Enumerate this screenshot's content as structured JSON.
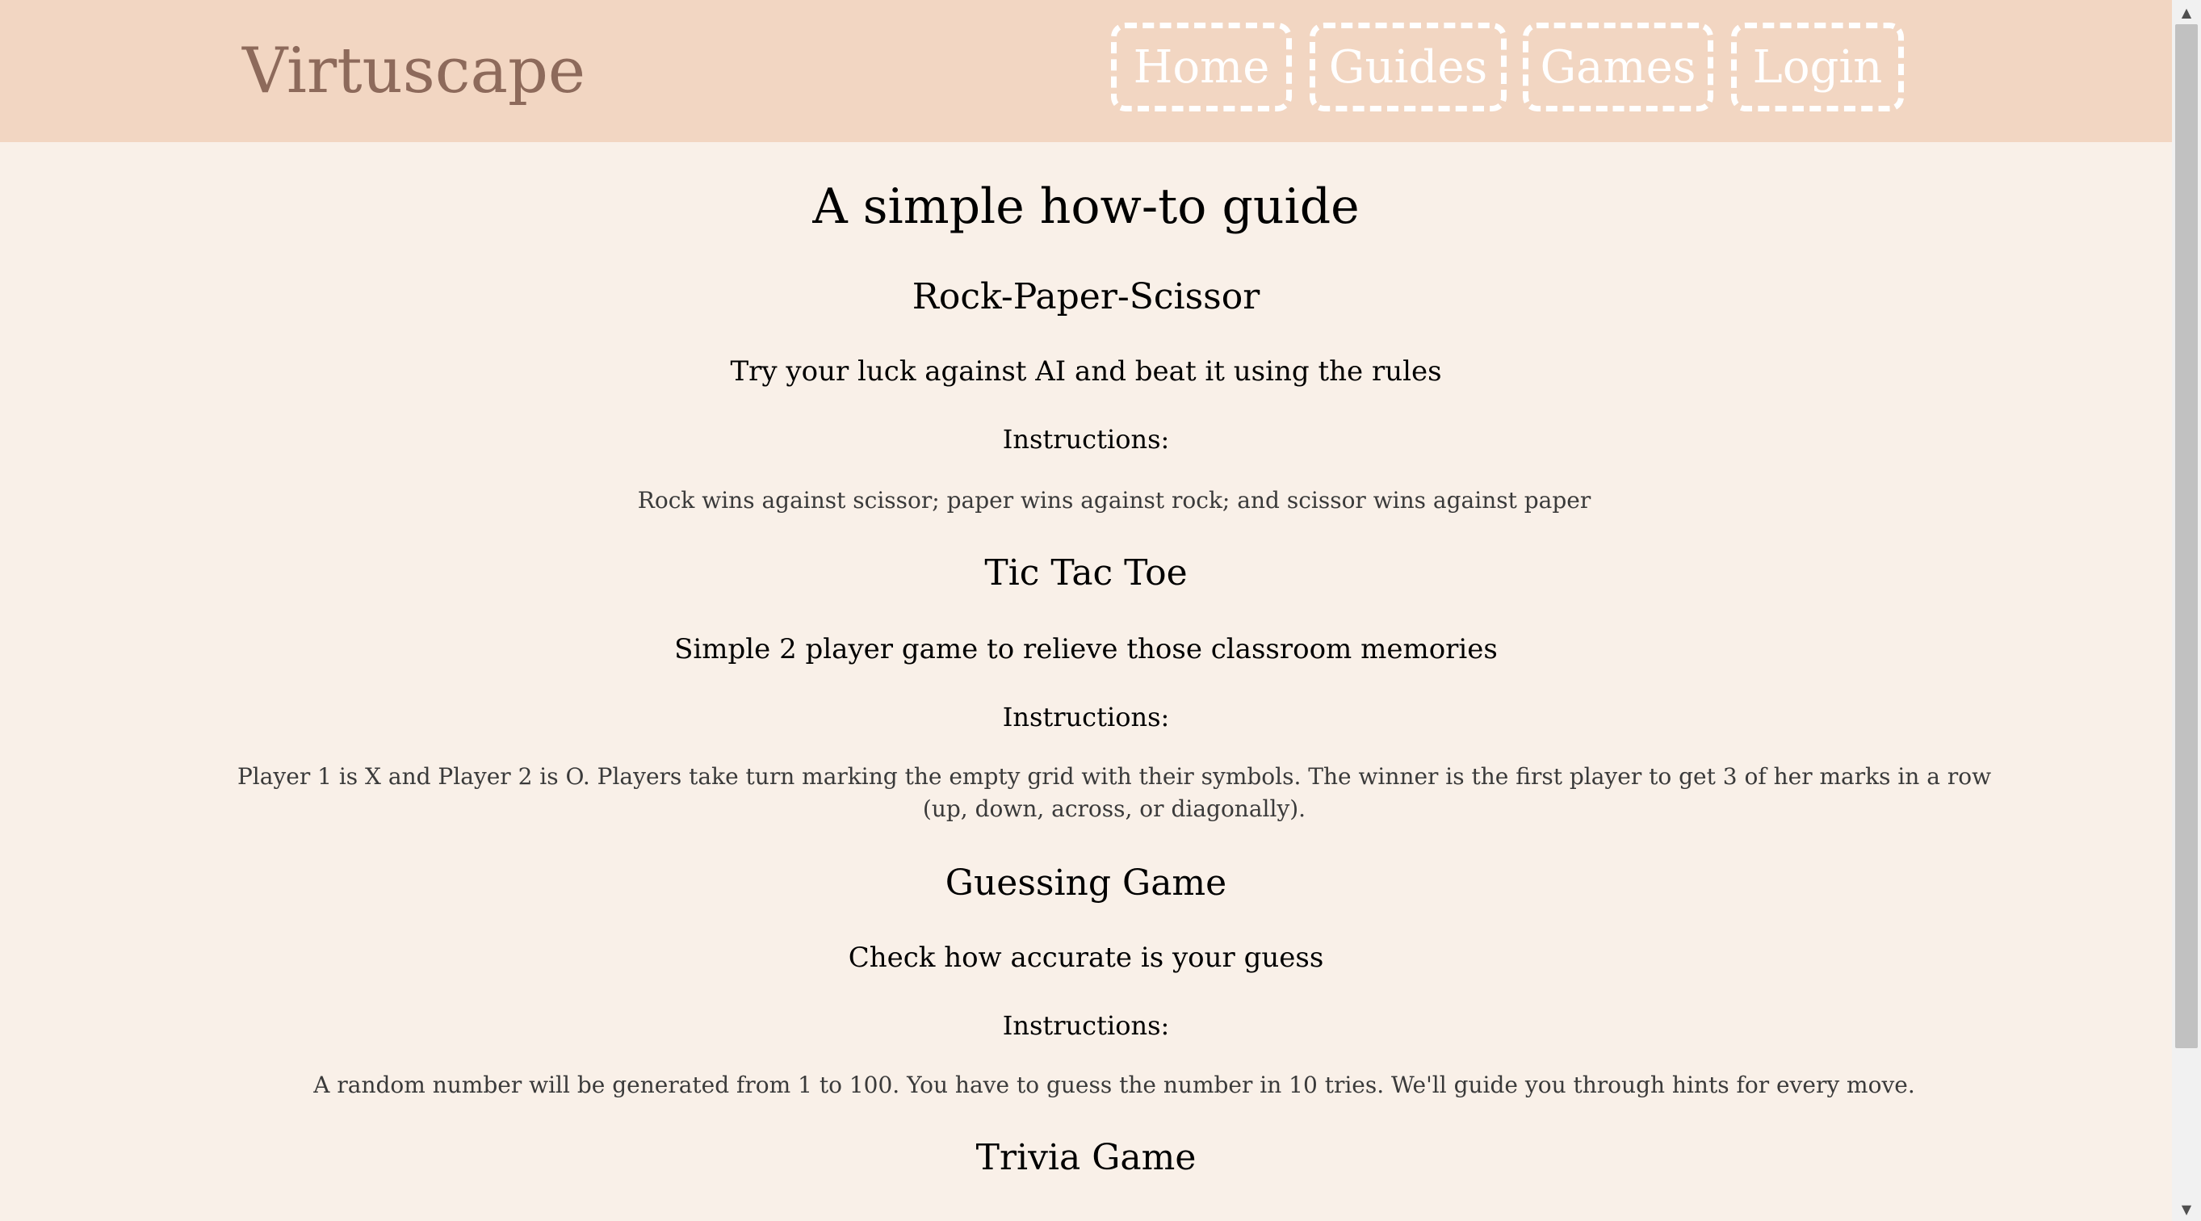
{
  "header": {
    "brand": "Virtuscape",
    "nav": [
      {
        "label": "Home"
      },
      {
        "label": "Guides"
      },
      {
        "label": "Games"
      },
      {
        "label": "Login"
      }
    ]
  },
  "main": {
    "title": "A simple how-to guide",
    "games": [
      {
        "name": "Rock-Paper-Scissor",
        "tagline": "Try your luck against AI and beat it using the rules",
        "instructions_label": "Instructions:",
        "instructions": "Rock wins against scissor; paper wins against rock; and scissor wins against paper"
      },
      {
        "name": "Tic Tac Toe",
        "tagline": "Simple 2 player game to relieve those classroom memories",
        "instructions_label": "Instructions:",
        "instructions": "Player 1 is X and Player 2 is O. Players take turn marking the empty grid with their symbols. The winner is the first player to get 3 of her marks in a row (up, down, across, or diagonally)."
      },
      {
        "name": "Guessing Game",
        "tagline": "Check how accurate is your guess",
        "instructions_label": "Instructions:",
        "instructions": "A random number will be generated from 1 to 100. You have to guess the number in 10 tries. We'll guide you through hints for every move."
      },
      {
        "name": "Trivia Game"
      }
    ]
  },
  "colors": {
    "navbar_bg": "#f2d6c2",
    "page_bg": "#f9f0e8",
    "brand_text": "#8d6a5b",
    "nav_text": "#ffffff"
  },
  "icons": {
    "scroll_up": "triangle-up-icon",
    "scroll_down": "triangle-down-icon"
  }
}
